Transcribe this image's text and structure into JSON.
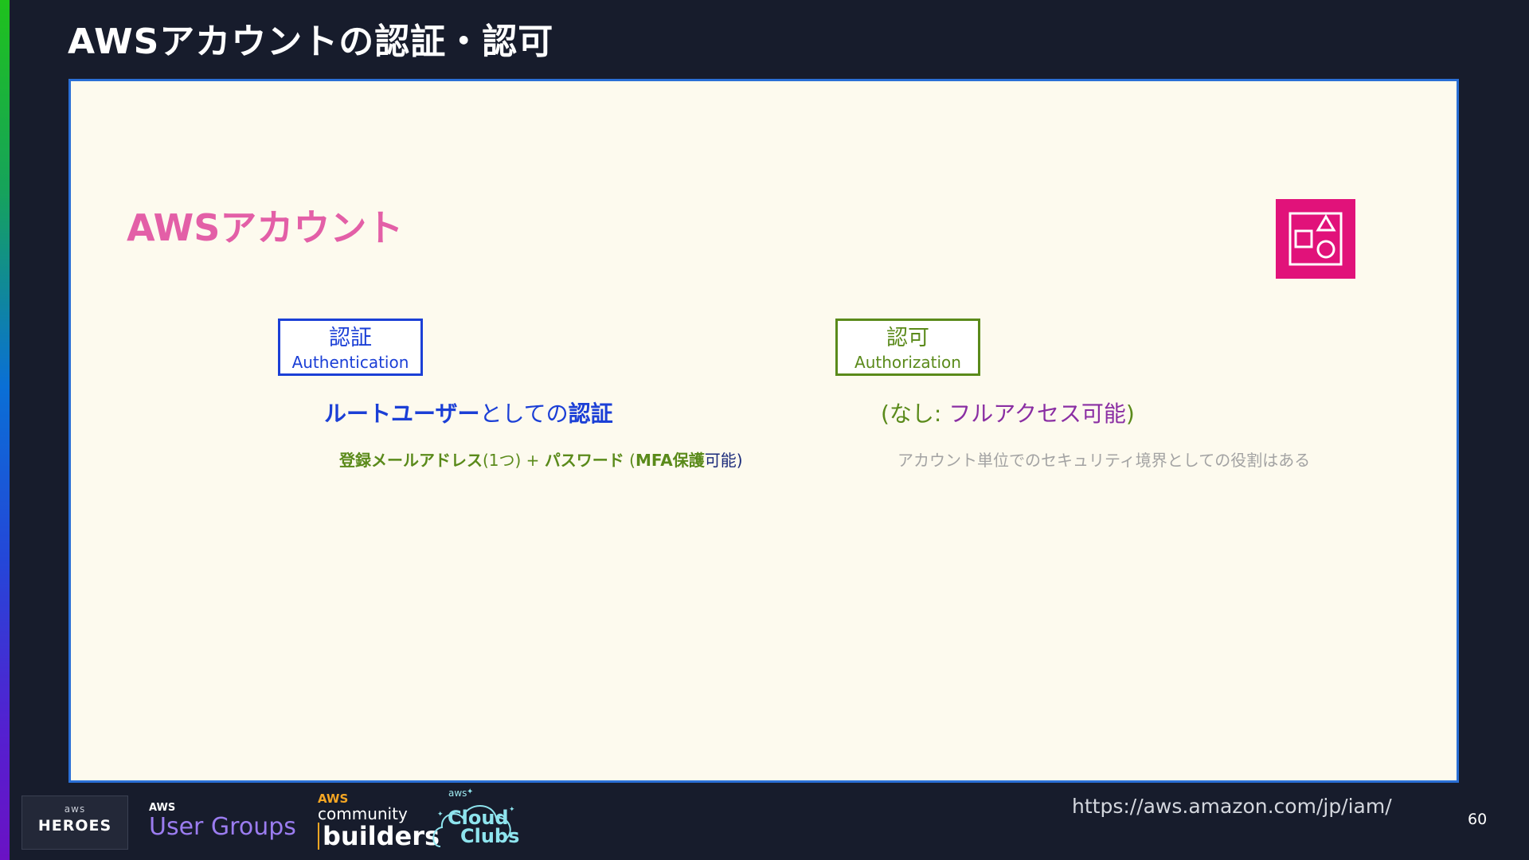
{
  "slide": {
    "title": "AWSアカウントの認証・認可",
    "section_title": "AWSアカウント"
  },
  "authentication": {
    "label_jp": "認証",
    "label_en": "Authentication",
    "headline_strong1": "ルートユーザー",
    "headline_mid": "としての",
    "headline_strong2": "認証",
    "detail_bold1": "登録メールアドレス",
    "detail_plain1": "(1つ) + ",
    "detail_bold2": "パスワード",
    "detail_plain2": " (",
    "detail_bold3": "MFA保護",
    "detail_plain3": "可能)"
  },
  "authorization": {
    "label_jp": "認可",
    "label_en": "Authorization",
    "headline_paren1": "(なし: ",
    "headline_main": "フルアクセス可能",
    "headline_paren2": ")",
    "detail": "アカウント単位でのセキュリティ境界としての役割はある"
  },
  "footer": {
    "heroes_aws": "aws",
    "heroes_label": "HEROES",
    "user_groups_aws": "AWS",
    "user_groups_label": "User Groups",
    "cb_aws": "AWS",
    "cb_community": "community",
    "cb_builders": "builders",
    "cc_aws": "aws",
    "cc_cloud": "Cloud",
    "cc_clubs": "Clubs",
    "url": "https://aws.amazon.com/jp/iam/",
    "page_number": "60"
  },
  "colors": {
    "background": "#171c2c",
    "panel": "#fdfaee",
    "panel_border": "#2a6fd6",
    "section_title": "#e35fa7",
    "icon_bg": "#e1127a",
    "auth_blue": "#1b3fd6",
    "authz_green": "#5a8a1a",
    "authz_purple": "#8a2ea3",
    "muted_gray": "#a3a3a3"
  },
  "icons": {
    "account": "shapes-icon"
  }
}
